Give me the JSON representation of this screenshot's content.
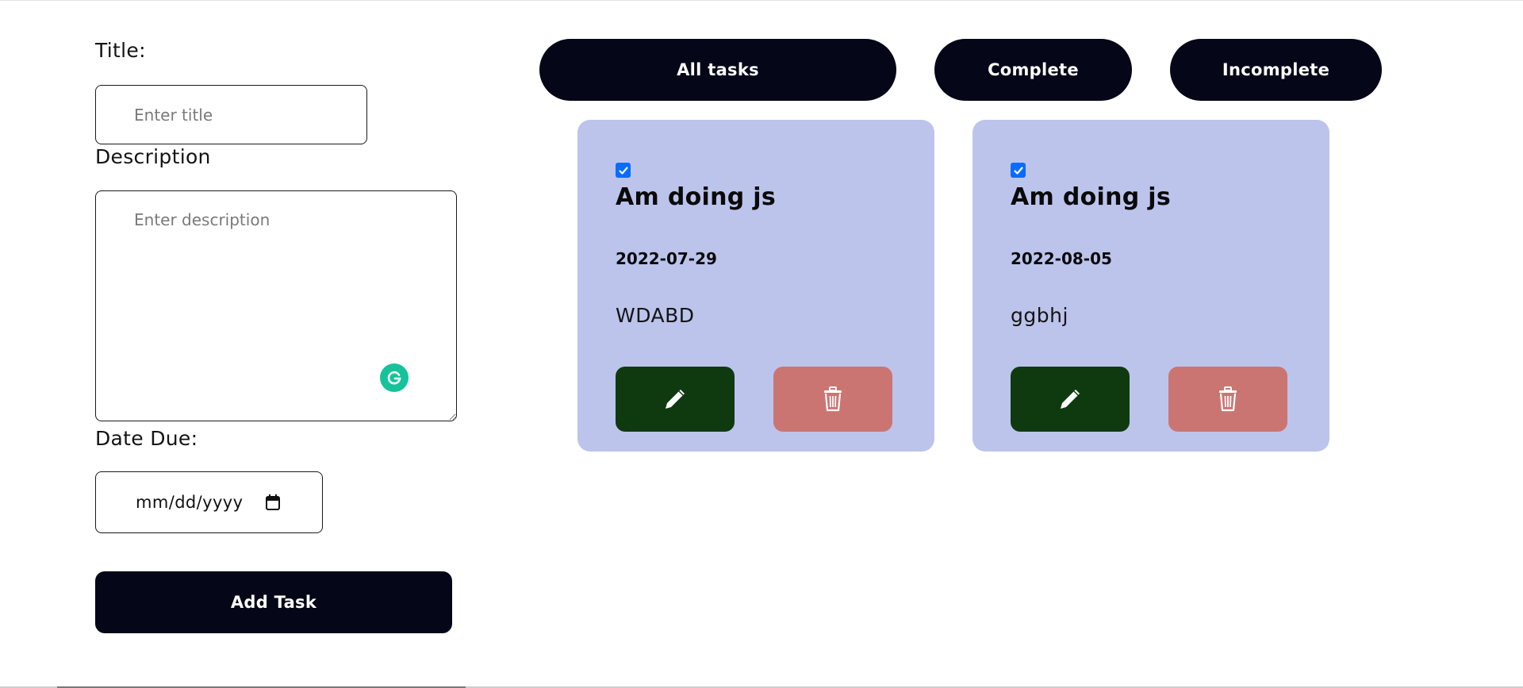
{
  "form": {
    "title_label": "Title:",
    "title_placeholder": "Enter title",
    "description_label": "Description",
    "description_placeholder": "Enter description",
    "date_label": "Date Due:",
    "date_value": "mm/dd/yyyy",
    "add_button": "Add Task"
  },
  "filters": {
    "all": "All tasks",
    "complete": "Complete",
    "incomplete": "Incomplete"
  },
  "tasks": [
    {
      "title": "Am doing js",
      "date": "2022-07-29",
      "description": "WDABD",
      "completed": true
    },
    {
      "title": "Am doing js",
      "date": "2022-08-05",
      "description": "ggbhj",
      "completed": true
    }
  ],
  "colors": {
    "primary": "#050617",
    "card_bg": "#bcc4ec",
    "edit": "#0f3a10",
    "delete": "#cb7572",
    "checkbox": "#0a6cff",
    "grammarly": "#15c39a"
  },
  "icons": {
    "edit": "pencil-icon",
    "delete": "trash-icon",
    "date": "calendar-icon",
    "checked": "checkmark-icon",
    "assistant": "grammarly-icon"
  }
}
